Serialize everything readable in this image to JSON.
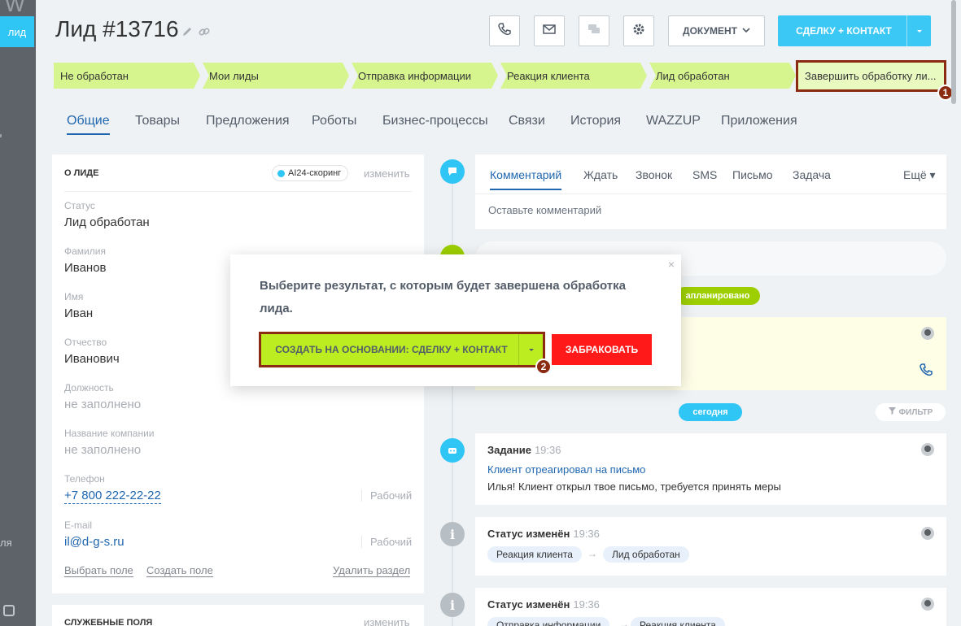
{
  "sidebar": {
    "corner_letter": "W",
    "active_tab": "лид",
    "side_text": "ля"
  },
  "header": {
    "title": "Лид #13716"
  },
  "toolbar": {
    "document_label": "ДОКУМЕНТ",
    "deal_label": "СДЕЛКУ + КОНТАКТ"
  },
  "stages": [
    {
      "label": "Не обработан"
    },
    {
      "label": "Мои лиды"
    },
    {
      "label": "Отправка информации"
    },
    {
      "label": "Реакция клиента"
    },
    {
      "label": "Лид обработан"
    },
    {
      "label": "Завершить обработку ли..."
    }
  ],
  "badges": {
    "one": "1",
    "two": "2"
  },
  "tabs": [
    "Общие",
    "Товары",
    "Предложения",
    "Роботы",
    "Бизнес-процессы",
    "Связи",
    "История",
    "WAZZUP",
    "Приложения"
  ],
  "about": {
    "title": "О ЛИДЕ",
    "ai_label": "AI24-скоринг",
    "change": "изменить",
    "fields": [
      {
        "label": "Статус",
        "value": "Лид обработан"
      },
      {
        "label": "Фамилия",
        "value": "Иванов"
      },
      {
        "label": "Имя",
        "value": "Иван"
      },
      {
        "label": "Отчество",
        "value": "Иванович"
      },
      {
        "label": "Должность",
        "value": "не заполнено"
      },
      {
        "label": "Название компании",
        "value": "не заполнено"
      },
      {
        "label": "Телефон",
        "value": "+7 800 222-22-22",
        "type": "Рабочий"
      },
      {
        "label": "E-mail",
        "value": "il@d-g-s.ru",
        "type": "Рабочий"
      }
    ],
    "actions": {
      "select_field": "Выбрать поле",
      "create_field": "Создать поле",
      "delete_section": "Удалить раздел"
    }
  },
  "service": {
    "title": "СЛУЖЕБНЫЕ ПОЛЯ",
    "change": "изменить"
  },
  "composer": {
    "tabs": [
      "Комментарий",
      "Ждать",
      "Звонок",
      "SMS",
      "Письмо",
      "Задача"
    ],
    "more": "Ещё",
    "placeholder": "Оставьте комментарий"
  },
  "timeline": {
    "planned_partial": "апланировано",
    "today": "сегодня",
    "filter": "ФИЛЬТР",
    "events": [
      {
        "title": "Задание",
        "time": "19:36",
        "link": "Клиент отреагировал на письмо",
        "text": "Илья! Клиент открыл твое письмо, требуется принять меры"
      },
      {
        "title": "Статус изменён",
        "time": "19:36",
        "from": "Реакция клиента",
        "to": "Лид обработан"
      },
      {
        "title": "Статус изменён",
        "time": "19:36",
        "from": "Отправка информации",
        "to": "Реакция клиента"
      }
    ]
  },
  "modal": {
    "text": "Выберите результат, с которым будет завершена обработка лида.",
    "primary": "СОЗДАТЬ НА ОСНОВАНИИ: СДЕЛКУ + КОНТАКТ",
    "reject": "ЗАБРАКОВАТЬ",
    "close": "×"
  },
  "colors": {
    "accent": "#2fc6f6",
    "stage": "#d6f58f",
    "primary_green": "#bbed21",
    "reject_red": "#ff1919",
    "highlight": "#8b2c12"
  }
}
